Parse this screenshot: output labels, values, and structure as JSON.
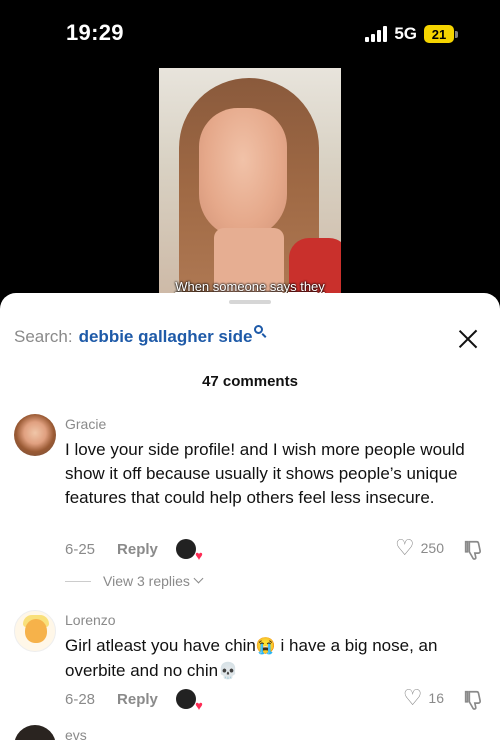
{
  "status_bar": {
    "time": "19:29",
    "network": "5G",
    "battery": "21"
  },
  "video": {
    "caption": "When someone says they"
  },
  "sheet": {
    "search_label": "Search:",
    "search_term": "debbie gallagher side",
    "comments_count": "47 comments"
  },
  "comments": [
    {
      "username": "Gracie",
      "text": "I love your side profile! and I wish more people would show it off because usually it shows people’s unique features that could help others feel less insecure.",
      "date": "6-25",
      "reply_label": "Reply",
      "likes": "250",
      "view_replies": "View 3 replies"
    },
    {
      "username": "Lorenzo",
      "text_part1": "Girl atleast you have chin",
      "emoji1": "😭",
      "text_part2": " i have a big nose, an overbite and no chin",
      "emoji2": "💀",
      "date": "6-28",
      "reply_label": "Reply",
      "likes": "16"
    },
    {
      "username": "evs"
    }
  ],
  "icons": {
    "search": "search-icon",
    "close": "close-icon",
    "heart": "heart-icon",
    "dislike": "dislike-icon",
    "creator_like": "creator-liked-icon"
  }
}
